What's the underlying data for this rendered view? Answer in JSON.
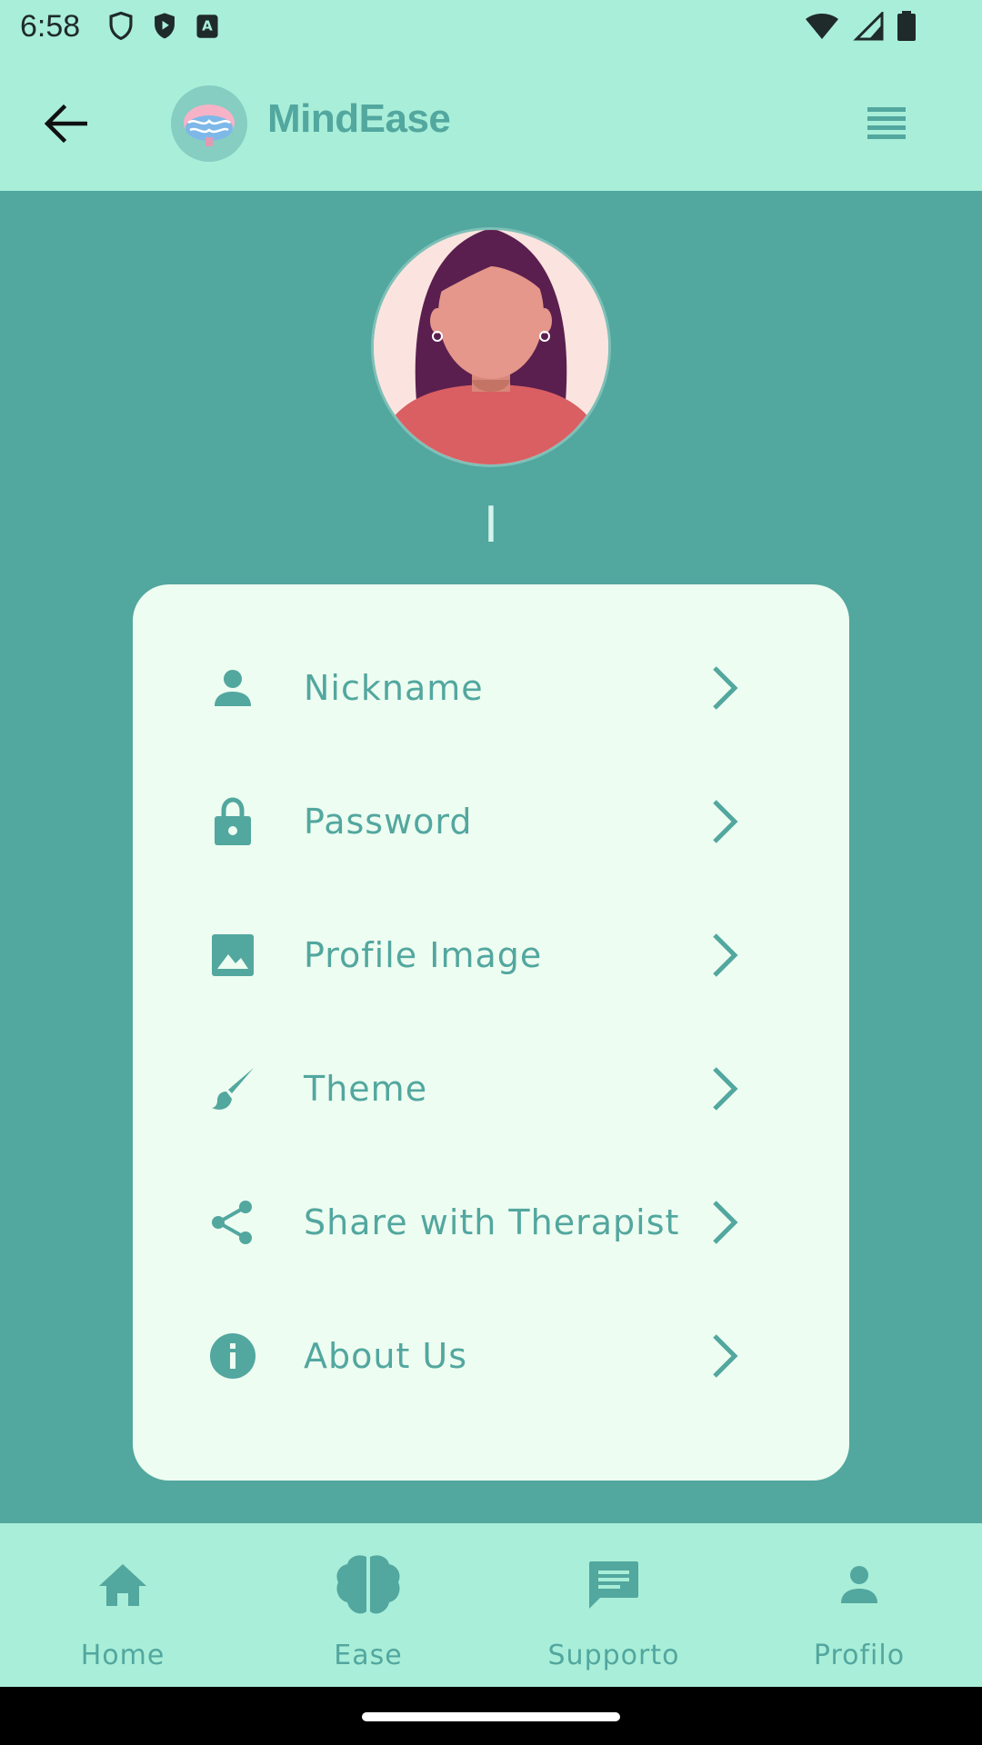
{
  "status": {
    "time": "6:58",
    "left_icons": [
      "shield-outline-icon",
      "shield-play-icon",
      "text-a-icon"
    ],
    "right_icons": [
      "wifi-icon",
      "signal-icon",
      "battery-icon"
    ]
  },
  "appbar": {
    "brand": "MindEase",
    "back_icon": "arrow-left-icon",
    "menu_icon": "list-icon"
  },
  "profile": {
    "username": "I"
  },
  "menu": {
    "items": [
      {
        "label": "Nickname",
        "icon": "person-icon"
      },
      {
        "label": "Password",
        "icon": "lock-icon"
      },
      {
        "label": "Profile Image",
        "icon": "image-icon"
      },
      {
        "label": "Theme",
        "icon": "brush-icon"
      },
      {
        "label": "Share with Therapist",
        "icon": "share-icon"
      },
      {
        "label": "About Us",
        "icon": "info-icon"
      }
    ]
  },
  "bottom_nav": {
    "items": [
      {
        "label": "Home",
        "icon": "home-icon"
      },
      {
        "label": "Ease",
        "icon": "brain-icon"
      },
      {
        "label": "Supporto",
        "icon": "chat-icon"
      },
      {
        "label": "Profilo",
        "icon": "person-icon"
      }
    ]
  },
  "colors": {
    "header_bg": "#a9eed8",
    "body_bg": "#52a79f",
    "card_bg": "#eefdf1",
    "accent": "#52a79f"
  }
}
